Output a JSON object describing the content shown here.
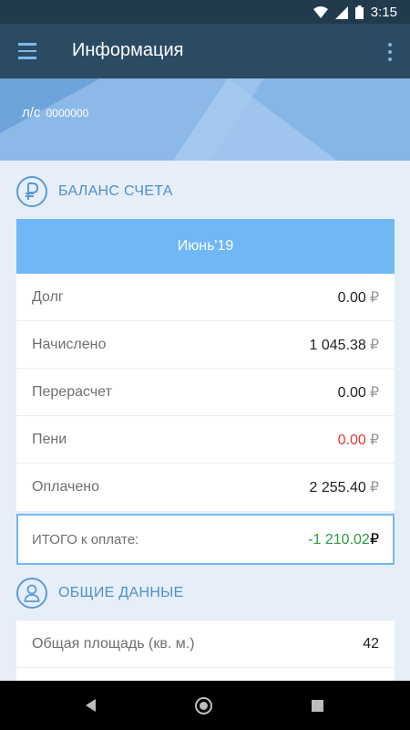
{
  "status": {
    "time": "3:15"
  },
  "appbar": {
    "title": "Информация"
  },
  "account": {
    "prefix": "л/с",
    "number": "0000000"
  },
  "balance": {
    "title": "БАЛАНС СЧЕТА",
    "period": "Июнь'19",
    "currency": "₽",
    "rows": [
      {
        "label": "Долг",
        "value": "0.00"
      },
      {
        "label": "Начислено",
        "value": "1 045.38"
      },
      {
        "label": "Перерасчет",
        "value": "0.00"
      },
      {
        "label": "Пени",
        "value": "0.00"
      },
      {
        "label": "Оплачено",
        "value": "2 255.40"
      }
    ],
    "total": {
      "label": "ИТОГО к оплате:",
      "value": "-1 210.02"
    }
  },
  "general": {
    "title": "ОБЩИЕ ДАННЫЕ",
    "rows": [
      {
        "label": "Общая площадь (кв. м.)",
        "value": "42"
      }
    ]
  },
  "colors": {
    "accent": "#6fb8f5",
    "appbar": "#2b4b62",
    "status": "#213b4d",
    "negative_value": "#e53935",
    "total_value": "#2e9a3c"
  }
}
